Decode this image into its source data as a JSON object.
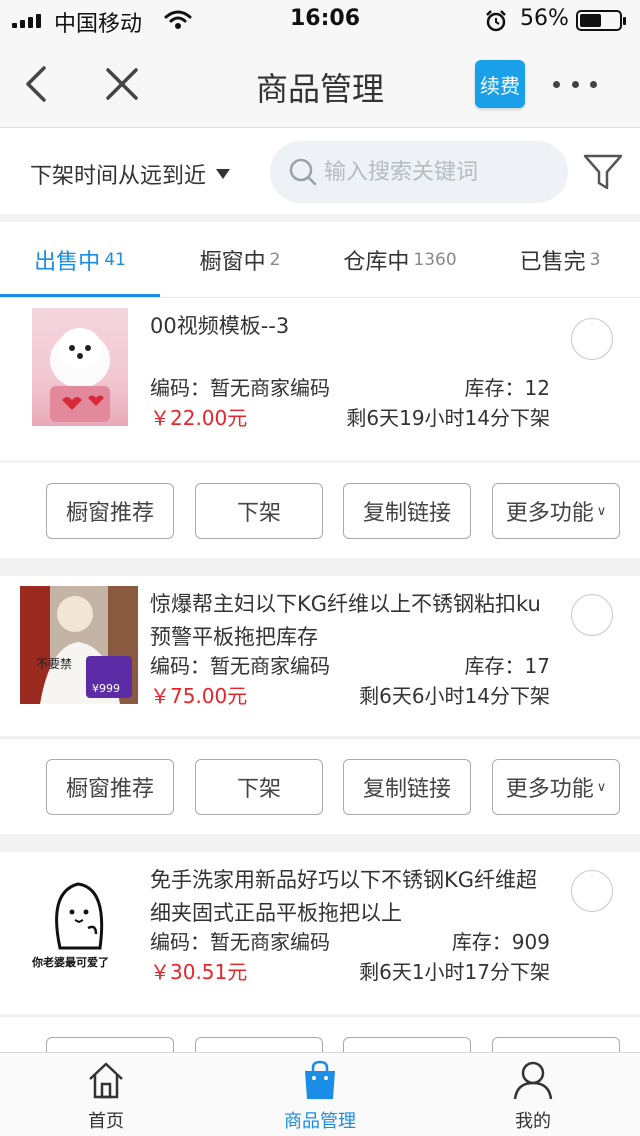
{
  "status_bar": {
    "carrier": "中国移动",
    "time": "16:06",
    "battery": "56%",
    "battery_level": 0.56
  },
  "nav": {
    "title": "商品管理",
    "renew_label": "续费"
  },
  "filter": {
    "sort_label": "下架时间从远到近",
    "search_placeholder": "输入搜索关键词"
  },
  "tabs": [
    {
      "label": "出售中",
      "count": "41",
      "active": true
    },
    {
      "label": "橱窗中",
      "count": "2",
      "active": false
    },
    {
      "label": "仓库中",
      "count": "1360",
      "active": false
    },
    {
      "label": "已售完",
      "count": "3",
      "active": false
    }
  ],
  "products": [
    {
      "title": "00视频模板--3",
      "code": "编码：暂无商家编码",
      "stock": "库存：12",
      "price": "￥22.00元",
      "time_left": "剩6天19小时14分下架"
    },
    {
      "title": "惊爆帮主妇以下KG纤维以上不锈钢粘扣ku预警平板拖把库存",
      "code": "编码：暂无商家编码",
      "stock": "库存：17",
      "price": "￥75.00元",
      "time_left": "剩6天6小时14分下架",
      "thumb_text_1": "不要禁",
      "thumb_text_2": "¥999"
    },
    {
      "title": "免手洗家用新品好巧以下不锈钢KG纤维超细夹固式正品平板拖把以上",
      "code": "编码：暂无商家编码",
      "stock": "库存：909",
      "price": "￥30.51元",
      "time_left": "剩6天1小时17分下架",
      "thumb_caption": "你老婆最可爱了"
    }
  ],
  "actions": {
    "window_recommend": "橱窗推荐",
    "delist": "下架",
    "copy_link": "复制链接",
    "more": "更多功能"
  },
  "tabbar": [
    {
      "label": "首页",
      "icon": "home-icon",
      "active": false
    },
    {
      "label": "商品管理",
      "icon": "shopping-bag-icon",
      "active": true
    },
    {
      "label": "我的",
      "icon": "person-icon",
      "active": false
    }
  ],
  "colors": {
    "accent": "#1a8de6",
    "price": "#e8242b",
    "renew_button": "#1aa0e8"
  }
}
